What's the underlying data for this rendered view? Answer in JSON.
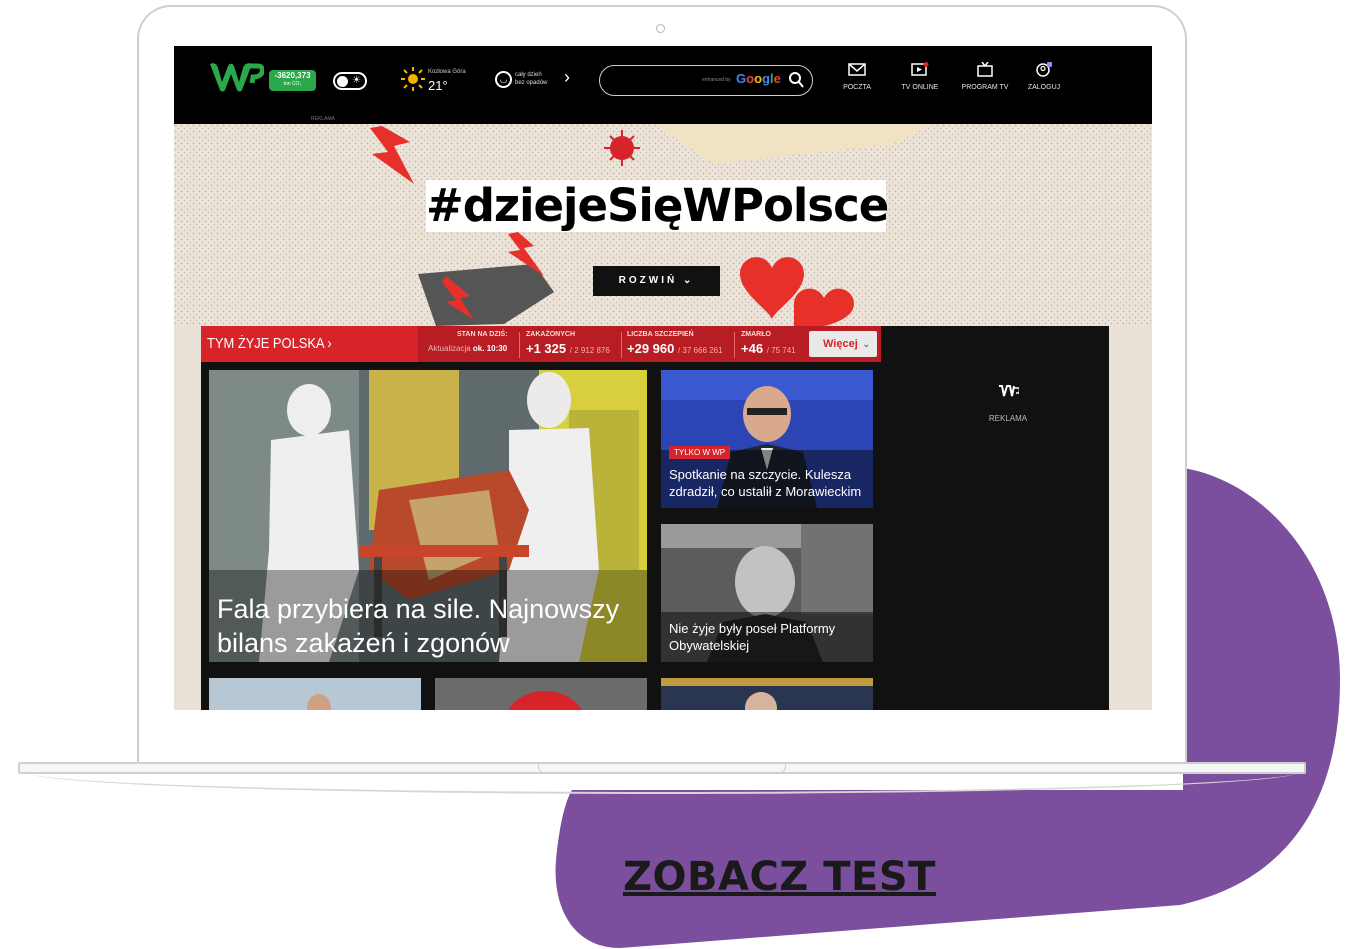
{
  "brand": {
    "logo_text": "WP"
  },
  "topbar": {
    "co2_value": "-3620,373",
    "co2_unit": "ton CO₂",
    "reklama": "REKLAMA",
    "weather": {
      "city": "Kozłowa Góra",
      "temp": "21°"
    },
    "forecast": {
      "line1": "cały dzień",
      "line2": "bez opadów"
    },
    "search": {
      "placeholder": "",
      "powered_by": "enhanced by",
      "google": "Google"
    },
    "nav": [
      {
        "label": "POCZTA",
        "icon": "mail-icon"
      },
      {
        "label": "TV ONLINE",
        "icon": "tv-play-icon"
      },
      {
        "label": "PROGRAM TV",
        "icon": "tv-icon"
      },
      {
        "label": "ZALOGUJ",
        "icon": "user-icon"
      }
    ]
  },
  "banner": {
    "hashtag": "#dziejeSięWPolsce",
    "button": "ROZWIŃ ⌄"
  },
  "covid": {
    "section_title": "TYM ŻYJE POLSKA ›",
    "stan": "STAN NA DZIŚ:",
    "update_prefix": "Aktualizacja",
    "update_time": "ok. 10:30",
    "stats": [
      {
        "label": "ZAKAŻONYCH",
        "value": "+1 325",
        "total": "/ 2 912 876"
      },
      {
        "label": "LICZBA SZCZEPIEŃ",
        "value": "+29 960",
        "total": "/ 37 666 261"
      },
      {
        "label": "ZMARŁO",
        "value": "+46",
        "total": "/ 75 741"
      }
    ],
    "more": "Więcej",
    "more_icon": "chevron-down-icon"
  },
  "articles": {
    "main_title": "Fala przybiera na sile. Najnowszy bilans zakażeń i zgonów",
    "side1_badge": "TYLKO W WP",
    "side1_title": "Spotkanie na szczycie. Kulesza zdradził, co ustalił z Morawieckim",
    "side2_title": "Nie żyje były poseł Platformy Obywatelskiej"
  },
  "ad": {
    "label": "REKLAMA"
  },
  "cta": "ZOBACZ TEST",
  "colors": {
    "purple": "#7b4f9d",
    "wp_green": "#2aa84a",
    "red": "#d7232a"
  }
}
